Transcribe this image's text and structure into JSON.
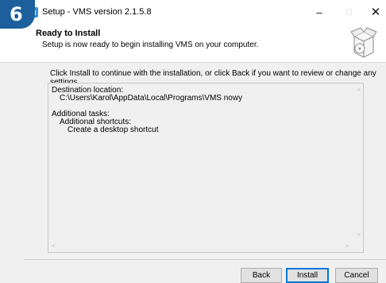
{
  "window": {
    "title": "Setup - VMS version 2.1.5.8",
    "minimize": "–",
    "maximize": "□",
    "close": "✕"
  },
  "step_badge": "6",
  "header": {
    "title": "Ready to Install",
    "subtitle": "Setup is now ready to begin installing VMS on your computer."
  },
  "intro_text": "Click Install to continue with the installation, or click Back if you want to review or change any settings.",
  "memo": {
    "lines": [
      "Destination location:",
      "C:\\Users\\Karol\\AppData\\Local\\Programs\\VMS nowy",
      "Additional tasks:",
      "Additional shortcuts:",
      "Create a desktop shortcut"
    ]
  },
  "buttons": {
    "back": "Back",
    "install": "Install",
    "cancel": "Cancel"
  },
  "colors": {
    "badge": "#1c5f9c",
    "accent": "#0078d7",
    "app_icon": "#2f8fe0"
  }
}
